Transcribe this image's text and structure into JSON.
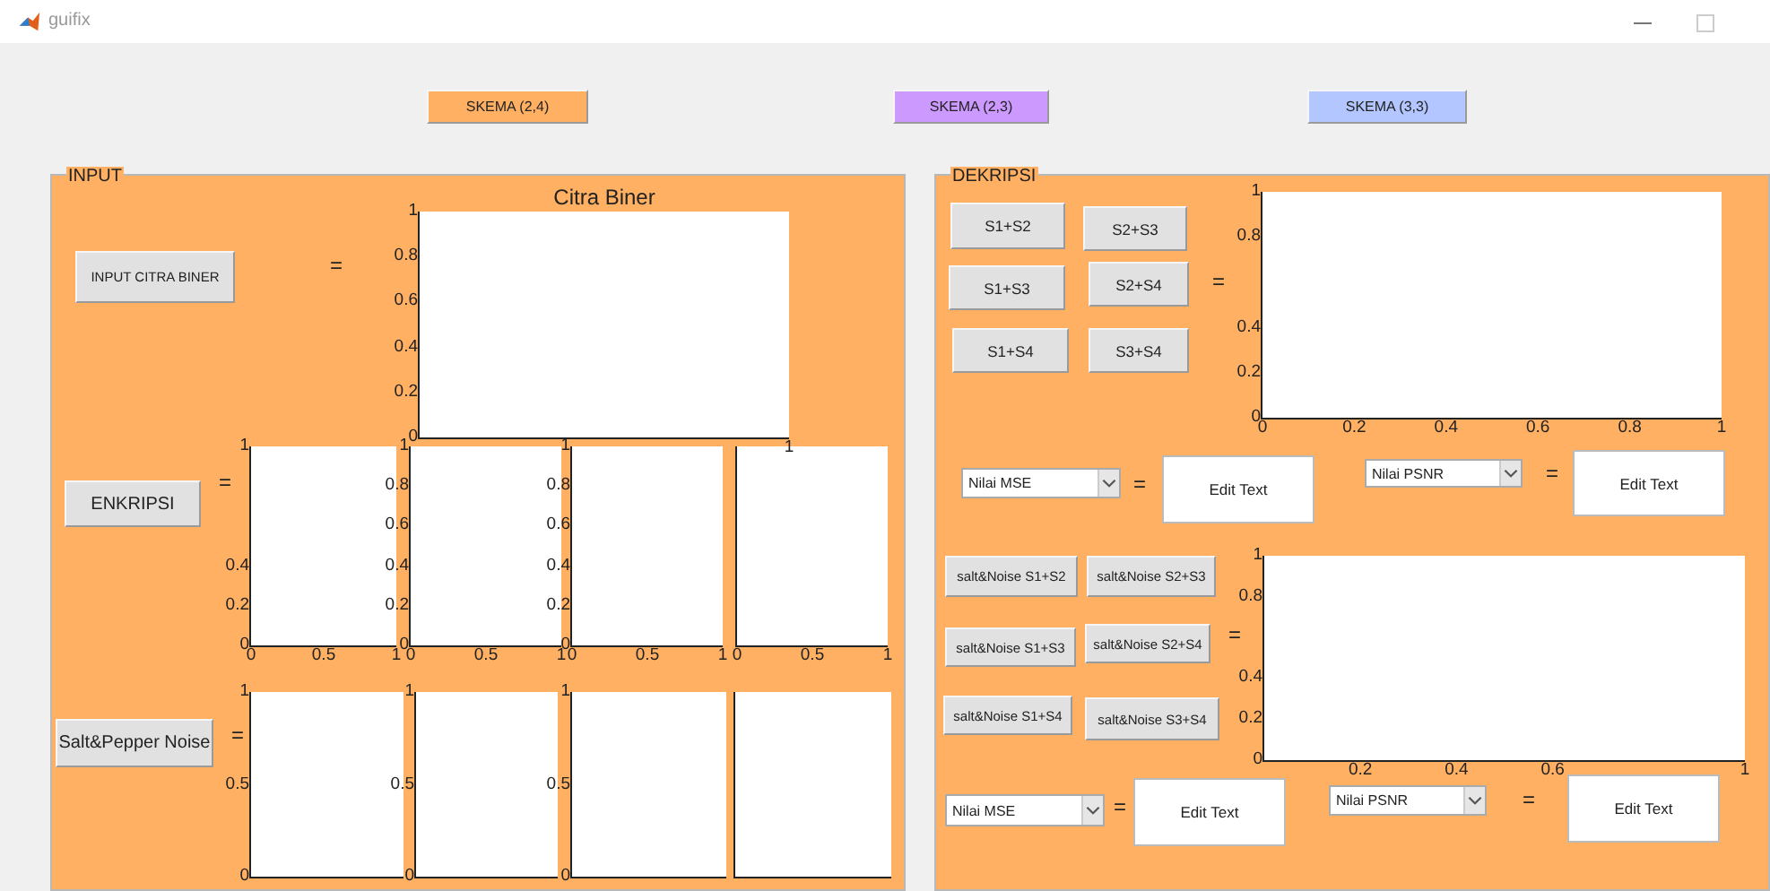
{
  "window": {
    "title": "guifix"
  },
  "scheme_buttons": [
    {
      "label": "SKEMA (2,4)",
      "color": "#ffb062"
    },
    {
      "label": "SKEMA (2,3)",
      "color": "#cc99ff"
    },
    {
      "label": "SKEMA (3,3)",
      "color": "#b3c6ff"
    }
  ],
  "input_panel": {
    "title": "INPUT",
    "input_button": "INPUT CITRA BINER",
    "input_equals": "=",
    "image_axes": {
      "kind": "axes",
      "title": "Citra Biner",
      "yticks": [
        "1",
        "0.8",
        "0.6",
        "0.4",
        "0.2",
        "0"
      ],
      "xticks": [
        "1"
      ]
    },
    "encrypt_button": "ENKRIPSI",
    "encrypt_equals": "=",
    "share_axes": [
      {
        "kind": "axes",
        "yticks": [
          "1",
          "0.4",
          "0.2",
          "0"
        ],
        "xticks": [
          "0",
          "0.5",
          "1"
        ]
      },
      {
        "kind": "axes",
        "yticks": [
          "1",
          "0.8",
          "0.6",
          "0.4",
          "0.2",
          "0"
        ],
        "xticks": [
          "0",
          "0.5",
          "1"
        ]
      },
      {
        "kind": "axes",
        "yticks": [
          "1",
          "0.8",
          "0.6",
          "0.4",
          "0.2",
          "0"
        ],
        "xticks": [
          "0",
          "0.5",
          "1"
        ]
      },
      {
        "kind": "axes",
        "xticks": [
          "0",
          "0.5",
          "1"
        ]
      }
    ],
    "noise_button": "Salt&Pepper Noise",
    "noise_equals": "=",
    "noise_axes": [
      {
        "kind": "axes",
        "yticks": [
          "1",
          "0.5",
          "0"
        ]
      },
      {
        "kind": "axes",
        "yticks": [
          "1",
          "0.5",
          "0"
        ]
      },
      {
        "kind": "axes",
        "yticks": [
          "1",
          "0.5",
          "0"
        ]
      },
      {
        "kind": "axes"
      }
    ]
  },
  "decrypt_panel": {
    "title": "DEKRIPSI",
    "combine_buttons": [
      "S1+S2",
      "S2+S3",
      "S1+S3",
      "S2+S4",
      "S1+S4",
      "S3+S4"
    ],
    "combine_equals": "=",
    "result_axes": {
      "kind": "axes",
      "yticks": [
        "1",
        "0.8",
        "0.4",
        "0.2",
        "0"
      ],
      "xticks": [
        "0",
        "0.2",
        "0.4",
        "0.6",
        "0.8",
        "1"
      ]
    },
    "noise_buttons": [
      "salt&Noise S1+S2",
      "salt&Noise S2+S3",
      "salt&Noise S1+S3",
      "salt&Noise S2+S4",
      "salt&Noise S1+S4",
      "salt&Noise S3+S4"
    ],
    "noise_equals": "=",
    "noise_axes": {
      "kind": "axes",
      "yticks": [
        "1",
        "0.8",
        "0.4",
        "0.2",
        "0"
      ],
      "xticks": [
        "0.2",
        "0.4",
        "0.6",
        "1"
      ]
    },
    "metrics": [
      {
        "dropdown": "Nilai MSE",
        "equals": "=",
        "value": "Edit Text"
      },
      {
        "dropdown": "Nilai PSNR",
        "equals": "=",
        "value": "Edit Text"
      },
      {
        "dropdown": "Nilai MSE",
        "equals": "=",
        "value": "Edit Text"
      },
      {
        "dropdown": "Nilai PSNR",
        "equals": "=",
        "value": "Edit Text"
      }
    ]
  }
}
